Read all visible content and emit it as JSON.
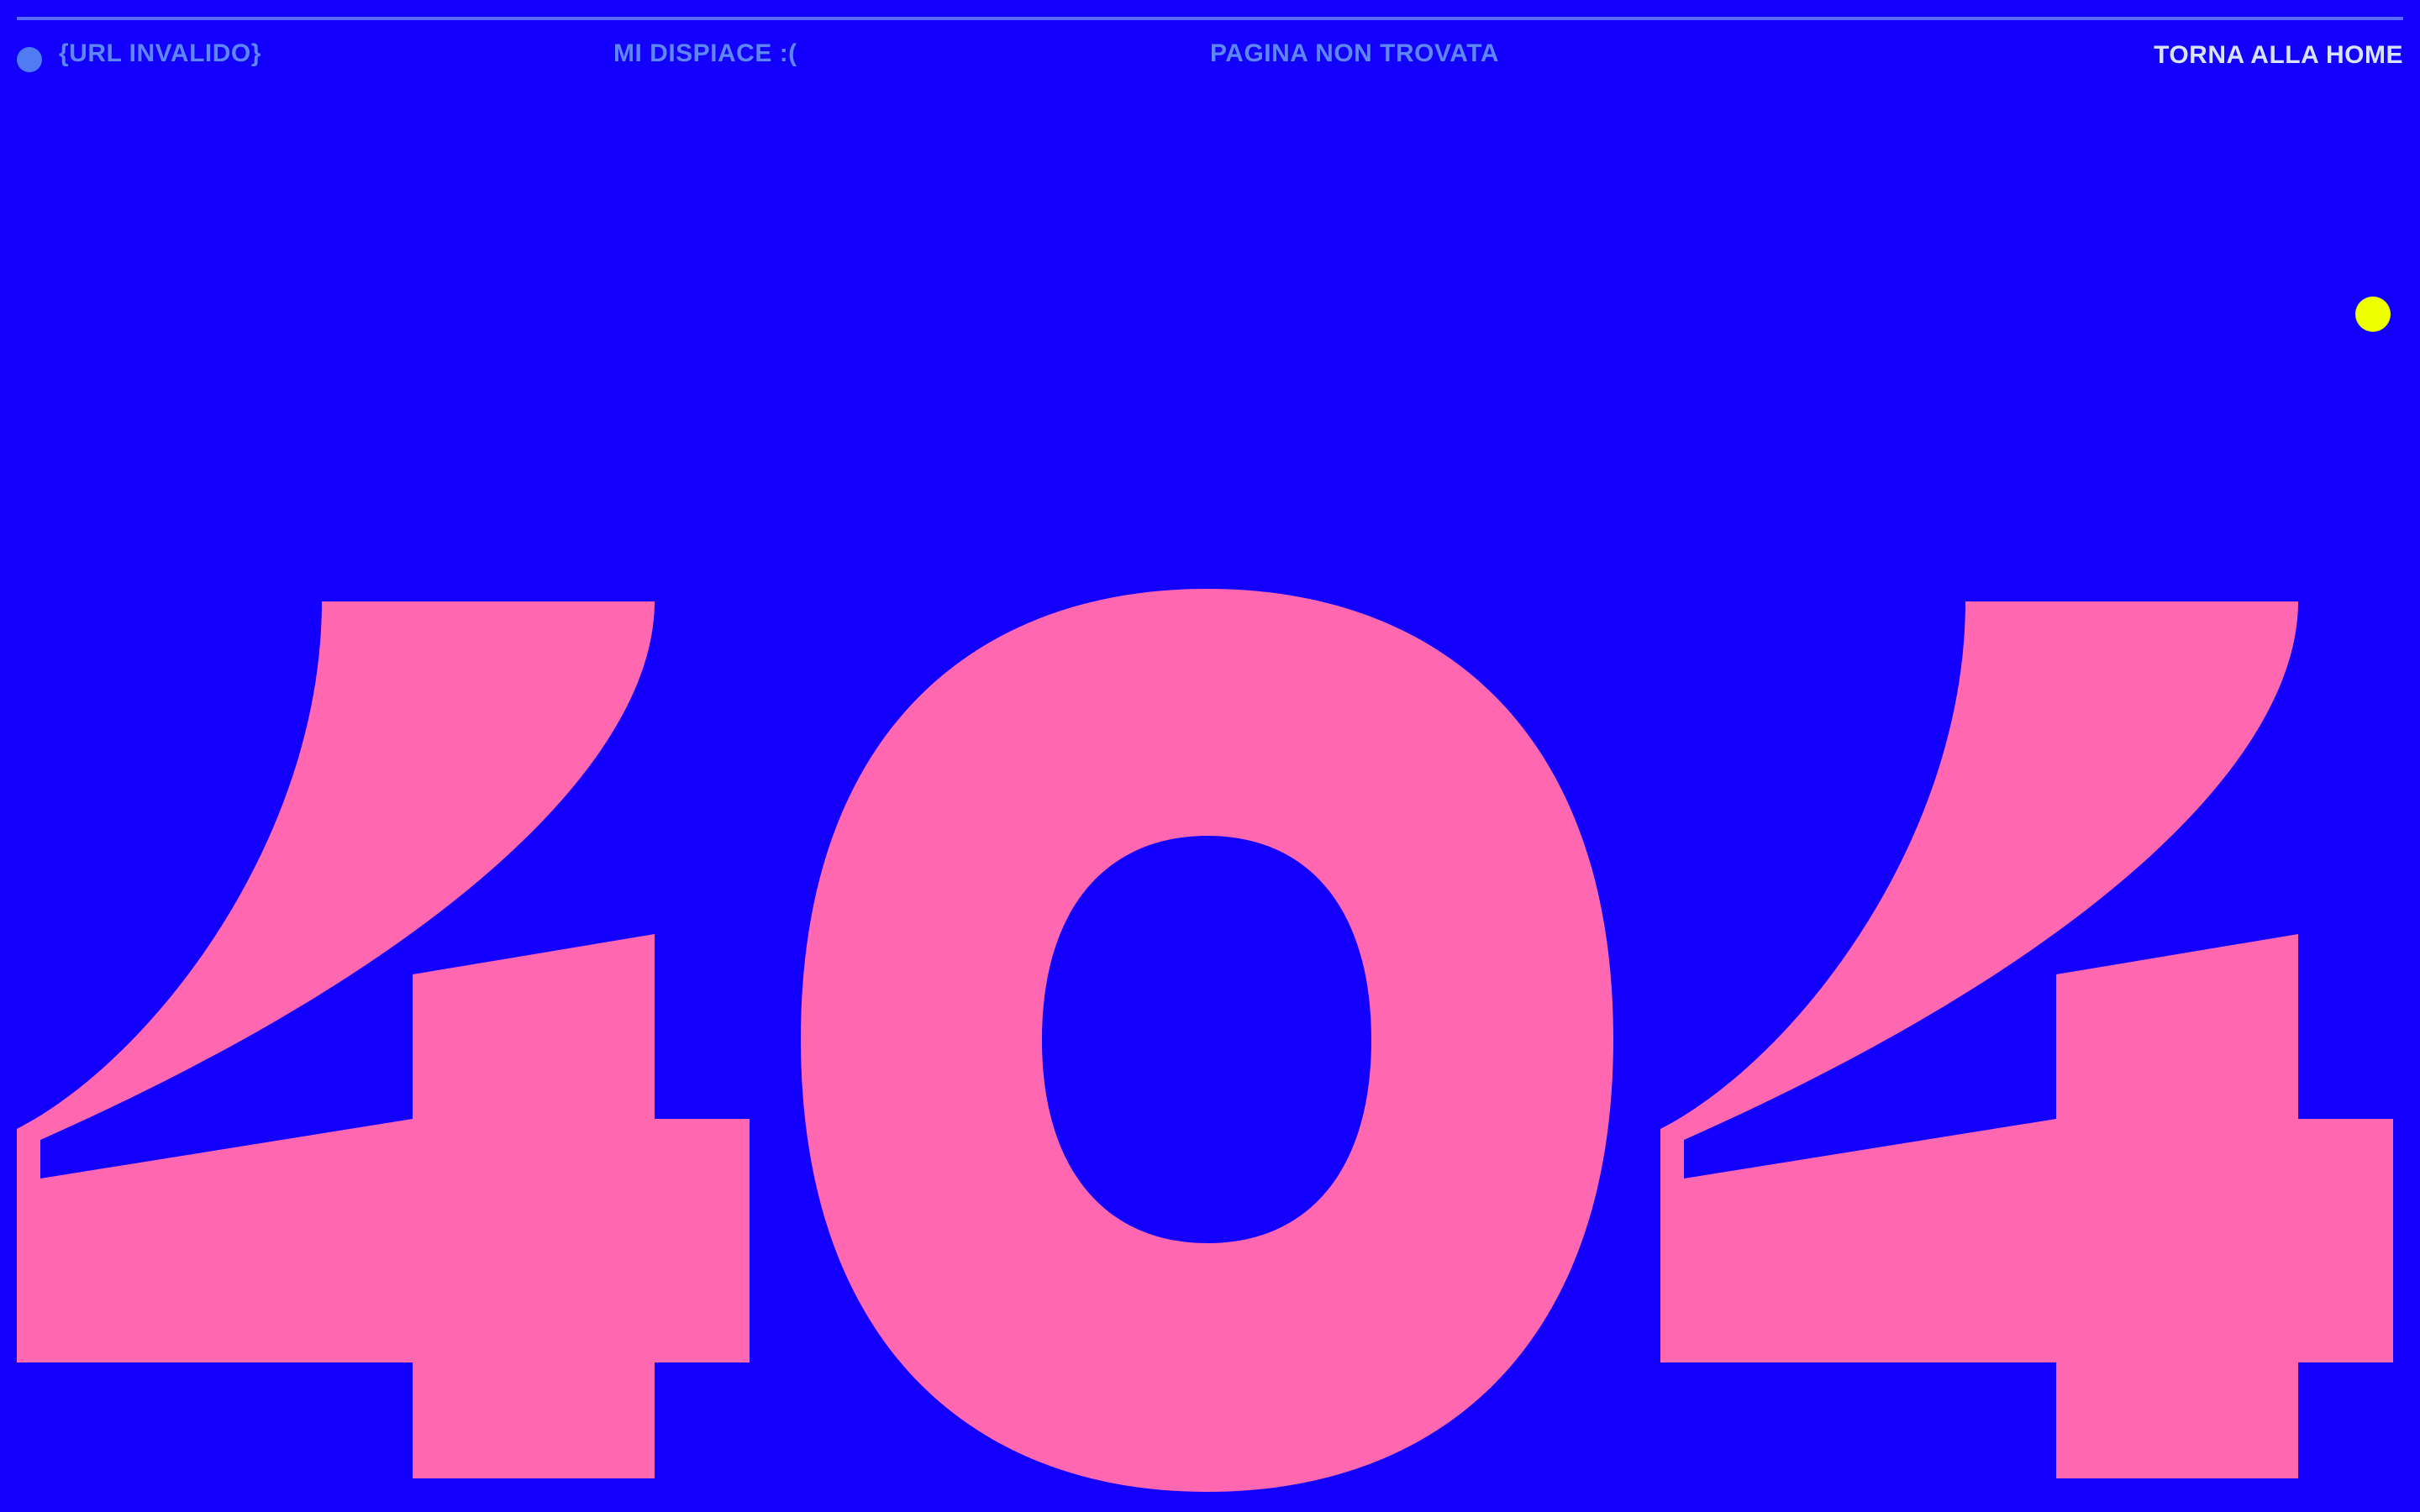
{
  "header": {
    "url_label": "{URL INVALIDO}",
    "apology": "MI DISPIACE :(",
    "not_found": "PAGINA NON TROVATA",
    "home_link": "TORNA ALLA HOME"
  },
  "hero": {
    "code": "404",
    "color": "#ff68b0"
  },
  "colors": {
    "background": "#1200fc",
    "header_text": "#5e86f5",
    "link_text": "#d9e3ff",
    "accent_dot": "#eeff00"
  }
}
